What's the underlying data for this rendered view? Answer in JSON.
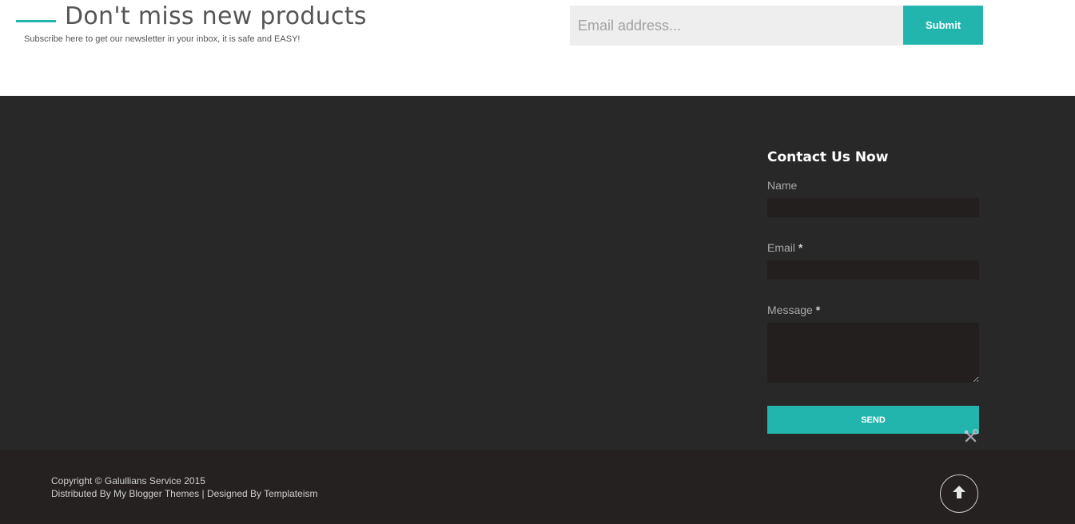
{
  "colors": {
    "accent": "#22b5ad",
    "footer_main_bg": "#282828",
    "footer_bottom_bg": "#242120"
  },
  "newsletter": {
    "title": "Don't miss new products",
    "subtitle": "Subscribe here to get our newsletter in your inbox, it is safe and EASY!",
    "email_placeholder": "Email address...",
    "email_value": "",
    "submit_label": "Submit"
  },
  "contact": {
    "title": "Contact Us Now",
    "name_label": "Name",
    "email_label": "Email",
    "message_label": "Message",
    "required_mark": "*",
    "name_value": "",
    "email_value": "",
    "message_value": "",
    "send_label": "SEND",
    "tools_icon": "tools-icon"
  },
  "footer": {
    "copyright": "Copyright © Galullians Service 2015",
    "credits": "Distributed By My Blogger Themes | Designed By Templateism",
    "back_to_top_icon": "arrow-up-icon"
  }
}
